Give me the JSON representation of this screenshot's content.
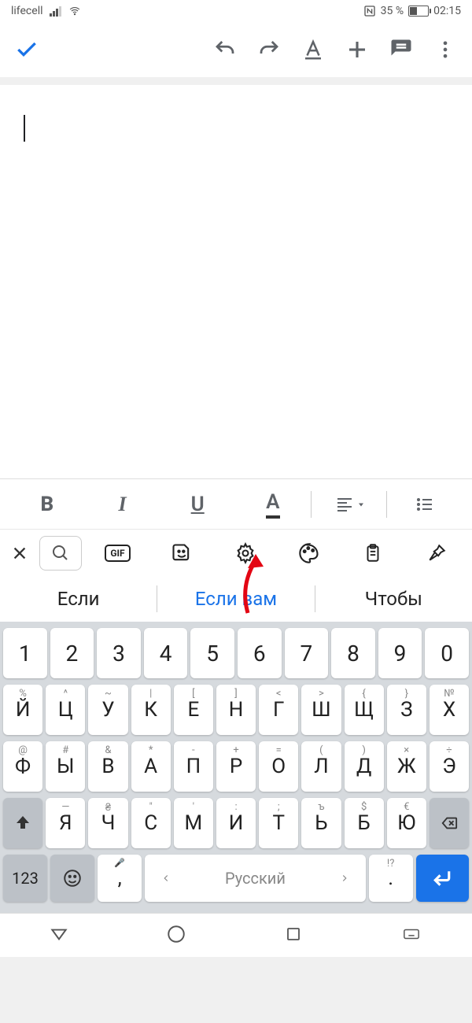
{
  "status": {
    "carrier": "lifecell",
    "battery_pct": "35 %",
    "battery_width_pct": 35,
    "time": "02:15"
  },
  "document": {
    "content": ""
  },
  "format_toolbar": {
    "bold": "B",
    "italic": "I",
    "underline": "U",
    "color": "A"
  },
  "keyboard_toolbar": {
    "gif_label": "GIF"
  },
  "suggestions": [
    "Если",
    "Если вам",
    "Чтобы"
  ],
  "keyboard": {
    "numbers": [
      "1",
      "2",
      "3",
      "4",
      "5",
      "6",
      "7",
      "8",
      "9",
      "0"
    ],
    "row2": [
      {
        "m": "Й",
        "a": "%"
      },
      {
        "m": "Ц",
        "a": "^"
      },
      {
        "m": "У",
        "a": "~"
      },
      {
        "m": "К",
        "a": "|"
      },
      {
        "m": "Е",
        "a": "["
      },
      {
        "m": "Н",
        "a": "]"
      },
      {
        "m": "Г",
        "a": "<"
      },
      {
        "m": "Ш",
        "a": ">"
      },
      {
        "m": "Щ",
        "a": "{"
      },
      {
        "m": "З",
        "a": "}"
      },
      {
        "m": "Х",
        "a": "№"
      }
    ],
    "row3": [
      {
        "m": "Ф",
        "a": "@"
      },
      {
        "m": "Ы",
        "a": "#"
      },
      {
        "m": "В",
        "a": "&"
      },
      {
        "m": "А",
        "a": "*"
      },
      {
        "m": "П",
        "a": "-"
      },
      {
        "m": "Р",
        "a": "+"
      },
      {
        "m": "О",
        "a": "="
      },
      {
        "m": "Л",
        "a": "("
      },
      {
        "m": "Д",
        "a": ")"
      },
      {
        "m": "Ж",
        "a": "×"
      },
      {
        "m": "Э",
        "a": "÷"
      }
    ],
    "row4": [
      {
        "m": "Я",
        "a": "—"
      },
      {
        "m": "Ч",
        "a": "₴"
      },
      {
        "m": "С",
        "a": "\""
      },
      {
        "m": "М",
        "a": "'"
      },
      {
        "m": "И",
        "a": ":"
      },
      {
        "m": "Т",
        "a": ";"
      },
      {
        "m": "Ь",
        "a": "ъ"
      },
      {
        "m": "Б",
        "a": "$"
      },
      {
        "m": "Ю",
        "a": "€"
      }
    ],
    "row5": {
      "num_switch": "123",
      "comma": ",",
      "comma_alt": "🎤",
      "space": "Русский",
      "period": ".",
      "period_alt": "!?"
    }
  }
}
